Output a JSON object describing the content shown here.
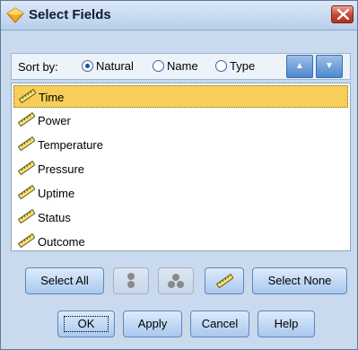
{
  "dialog": {
    "title": "Select Fields",
    "close_glyph": "✕"
  },
  "sort": {
    "label": "Sort by:",
    "options": [
      {
        "label": "Natural",
        "checked": true
      },
      {
        "label": "Name",
        "checked": false
      },
      {
        "label": "Type",
        "checked": false
      }
    ],
    "ascending_glyph": "▲",
    "descending_glyph": "▼"
  },
  "fields": [
    {
      "label": "Time",
      "selected": true,
      "icon": "continuous-ruler-icon"
    },
    {
      "label": "Power",
      "selected": false,
      "icon": "continuous-ruler-icon"
    },
    {
      "label": "Temperature",
      "selected": false,
      "icon": "continuous-ruler-icon"
    },
    {
      "label": "Pressure",
      "selected": false,
      "icon": "continuous-ruler-icon"
    },
    {
      "label": "Uptime",
      "selected": false,
      "icon": "continuous-ruler-icon"
    },
    {
      "label": "Status",
      "selected": false,
      "icon": "continuous-ruler-icon"
    },
    {
      "label": "Outcome",
      "selected": false,
      "icon": "continuous-ruler-icon"
    }
  ],
  "selection_buttons": {
    "select_all": "Select All",
    "select_none": "Select None",
    "icons": [
      "flag-type-icon",
      "set-type-icon",
      "continuous-type-icon"
    ]
  },
  "footer": {
    "ok": "OK",
    "apply": "Apply",
    "cancel": "Cancel",
    "help": "Help"
  },
  "colors": {
    "selection": "#f7cf58",
    "panel": "#c9daee",
    "close": "#c44733"
  }
}
